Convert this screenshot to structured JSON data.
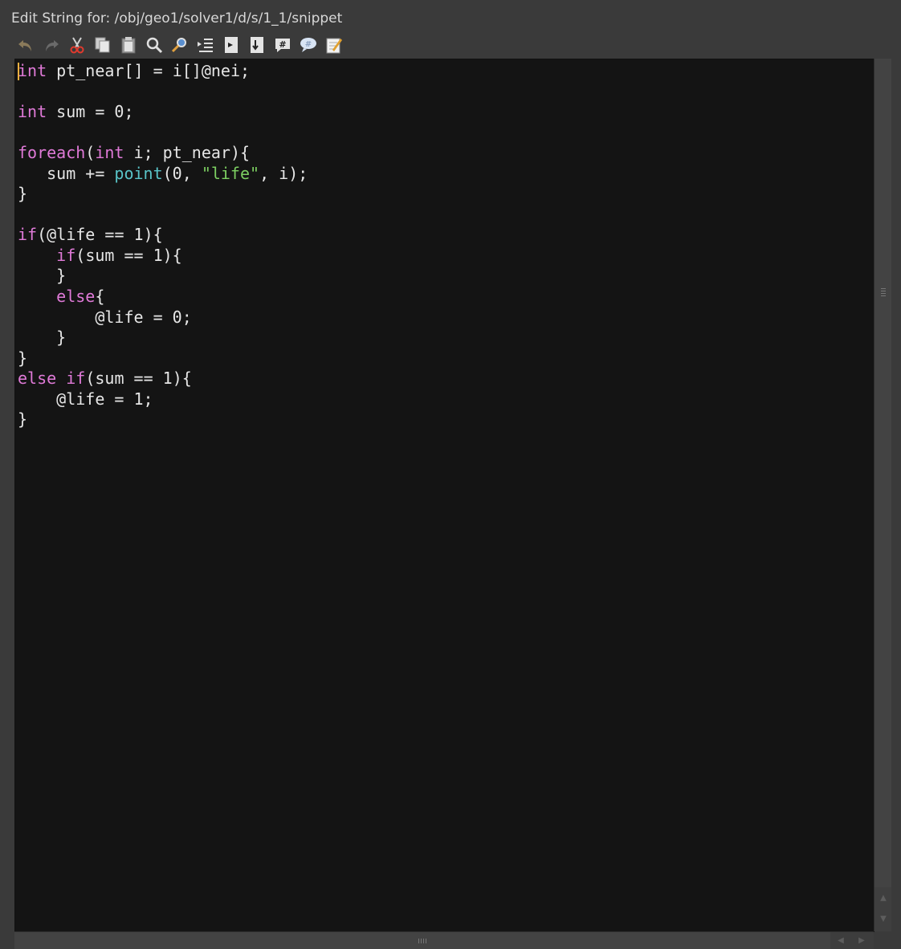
{
  "window": {
    "title": "Edit String for: /obj/geo1/solver1/d/s/1_1/snippet"
  },
  "toolbar": {
    "buttons": [
      {
        "name": "undo-icon"
      },
      {
        "name": "redo-icon"
      },
      {
        "name": "cut-icon"
      },
      {
        "name": "copy-icon"
      },
      {
        "name": "paste-icon"
      },
      {
        "name": "find-icon"
      },
      {
        "name": "find-replace-icon"
      },
      {
        "name": "indent-icon"
      },
      {
        "name": "goto-line-icon"
      },
      {
        "name": "goto-end-icon"
      },
      {
        "name": "comment-icon"
      },
      {
        "name": "uncomment-icon"
      },
      {
        "name": "external-editor-icon"
      }
    ]
  },
  "editor": {
    "code_lines": [
      "int pt_near[] = i[]@nei;",
      "",
      "int sum = 0;",
      "",
      "foreach(int i; pt_near){",
      "   sum += point(0, \"life\", i);",
      "}",
      "",
      "if(@life == 1){",
      "    if(sum == 1){",
      "    }",
      "    else{",
      "        @life = 0;",
      "    }",
      "}",
      "else if(sum == 1){",
      "    @life = 1;",
      "}"
    ],
    "colors": {
      "background": "#141414",
      "text": "#e6e6e6",
      "keyword": "#e07ad8",
      "function": "#59c4c8",
      "string": "#7ccf61",
      "caret": "#f0b040"
    },
    "keywords": [
      "int",
      "foreach",
      "if",
      "else"
    ],
    "functions": [
      "point"
    ]
  }
}
